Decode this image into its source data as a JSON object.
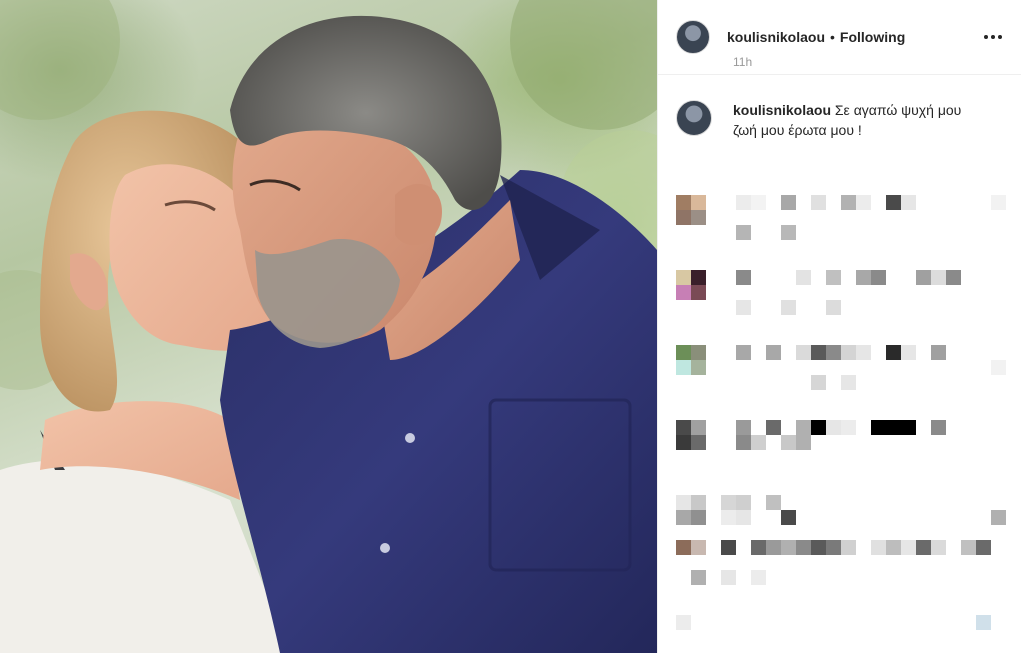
{
  "post": {
    "username": "koulisnikolaou",
    "separator": "•",
    "follow_status": "Following",
    "more_icon": "more-horizontal-icon",
    "caption_text": "Σε αγαπώ ψυχή μου ζωή μου έρωτα μου !",
    "time_ago": "11h"
  },
  "comments": {
    "pixelated": true,
    "rows": 9
  }
}
